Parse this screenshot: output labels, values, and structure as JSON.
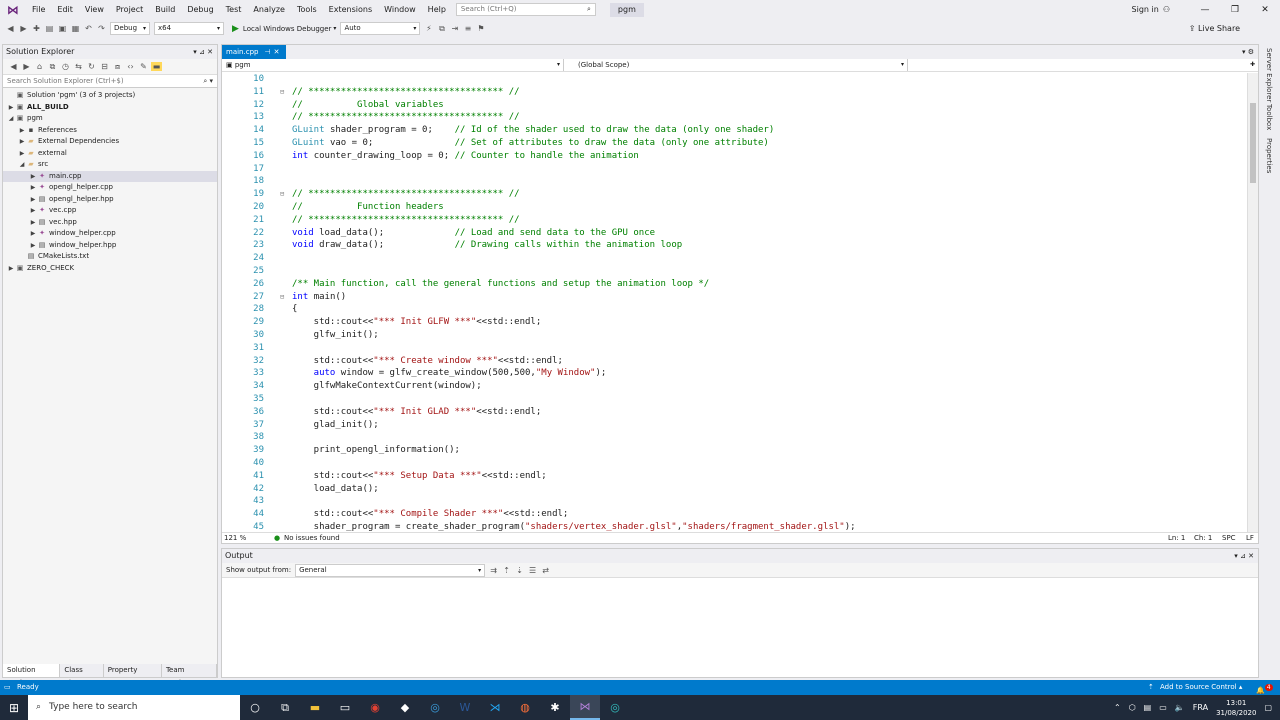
{
  "menubar": {
    "items": [
      "File",
      "Edit",
      "View",
      "Project",
      "Build",
      "Debug",
      "Test",
      "Analyze",
      "Tools",
      "Extensions",
      "Window",
      "Help"
    ],
    "search_placeholder": "Search (Ctrl+Q)",
    "solution_title": "pgm",
    "signin": "Sign in"
  },
  "toolbar": {
    "config": "Debug",
    "platform": "x64",
    "debugger": "Local Windows Debugger",
    "auto": "Auto",
    "liveshare": "Live Share"
  },
  "solution_explorer": {
    "title": "Solution Explorer",
    "search_placeholder": "Search Solution Explorer (Ctrl+$)",
    "nodes": [
      {
        "label": "Solution 'pgm' (3 of 3 projects)",
        "level": 0,
        "twisty": "",
        "icon": "solution-icon"
      },
      {
        "label": "ALL_BUILD",
        "level": 0,
        "twisty": "▶",
        "icon": "project-icon",
        "bold": true
      },
      {
        "label": "pgm",
        "level": 0,
        "twisty": "◢",
        "icon": "project-icon"
      },
      {
        "label": "References",
        "level": 1,
        "twisty": "▶",
        "icon": "references-icon"
      },
      {
        "label": "External Dependencies",
        "level": 1,
        "twisty": "▶",
        "icon": "folder-icon"
      },
      {
        "label": "external",
        "level": 1,
        "twisty": "▶",
        "icon": "folder-icon"
      },
      {
        "label": "src",
        "level": 1,
        "twisty": "◢",
        "icon": "folder-icon"
      },
      {
        "label": "main.cpp",
        "level": 2,
        "twisty": "▶",
        "icon": "cpp-file-icon",
        "selected": true
      },
      {
        "label": "opengl_helper.cpp",
        "level": 2,
        "twisty": "▶",
        "icon": "cpp-file-icon"
      },
      {
        "label": "opengl_helper.hpp",
        "level": 2,
        "twisty": "▶",
        "icon": "hpp-file-icon"
      },
      {
        "label": "vec.cpp",
        "level": 2,
        "twisty": "▶",
        "icon": "cpp-file-icon"
      },
      {
        "label": "vec.hpp",
        "level": 2,
        "twisty": "▶",
        "icon": "hpp-file-icon"
      },
      {
        "label": "window_helper.cpp",
        "level": 2,
        "twisty": "▶",
        "icon": "cpp-file-icon"
      },
      {
        "label": "window_helper.hpp",
        "level": 2,
        "twisty": "▶",
        "icon": "hpp-file-icon"
      },
      {
        "label": "CMakeLists.txt",
        "level": 1,
        "twisty": "",
        "icon": "text-file-icon"
      },
      {
        "label": "ZERO_CHECK",
        "level": 0,
        "twisty": "▶",
        "icon": "project-icon"
      }
    ],
    "bottom_tabs": [
      "Solution Expl...",
      "Class View",
      "Property Man...",
      "Team Explorer"
    ]
  },
  "editor": {
    "tab_label": "main.cpp",
    "nav_left": "pgm",
    "nav_right": "(Global Scope)",
    "zoom": "121 %",
    "issues": "No issues found",
    "ln": "Ln: 1",
    "ch": "Ch: 1",
    "spc": "SPC",
    "lf": "LF",
    "lines": [
      {
        "n": "10",
        "t": []
      },
      {
        "n": "11",
        "f": "⊟",
        "t": [
          [
            "cm",
            "// ************************************ //"
          ]
        ]
      },
      {
        "n": "12",
        "t": [
          [
            "cm",
            "//          Global variables"
          ]
        ]
      },
      {
        "n": "13",
        "t": [
          [
            "cm",
            "// ************************************ //"
          ]
        ]
      },
      {
        "n": "14",
        "t": [
          [
            "ty",
            "GLuint"
          ],
          [
            "",
            "shader_program = 0;    "
          ],
          [
            "cm",
            "// Id of the shader used to draw the data (only one shader)"
          ]
        ]
      },
      {
        "n": "15",
        "t": [
          [
            "ty",
            "GLuint"
          ],
          [
            "",
            "vao = 0;               "
          ],
          [
            "cm",
            "// Set of attributes to draw the data (only one attribute)"
          ]
        ]
      },
      {
        "n": "16",
        "t": [
          [
            "kw",
            "int"
          ],
          [
            "",
            "counter_drawing_loop = 0; "
          ],
          [
            "cm",
            "// Counter to handle the animation"
          ]
        ]
      },
      {
        "n": "17",
        "t": []
      },
      {
        "n": "18",
        "t": []
      },
      {
        "n": "19",
        "f": "⊟",
        "t": [
          [
            "cm",
            "// ************************************ //"
          ]
        ]
      },
      {
        "n": "20",
        "t": [
          [
            "cm",
            "//          Function headers"
          ]
        ]
      },
      {
        "n": "21",
        "t": [
          [
            "cm",
            "// ************************************ //"
          ]
        ]
      },
      {
        "n": "22",
        "t": [
          [
            "kw",
            "void"
          ],
          [
            "",
            "load_data();             "
          ],
          [
            "cm",
            "// Load and send data to the GPU once"
          ]
        ]
      },
      {
        "n": "23",
        "t": [
          [
            "kw",
            "void"
          ],
          [
            "",
            "draw_data();             "
          ],
          [
            "cm",
            "// Drawing calls within the animation loop"
          ]
        ]
      },
      {
        "n": "24",
        "t": []
      },
      {
        "n": "25",
        "t": []
      },
      {
        "n": "26",
        "t": [
          [
            "cm",
            "/** Main function, call the general functions and setup the animation loop */"
          ]
        ]
      },
      {
        "n": "27",
        "f": "⊟",
        "t": [
          [
            "kw",
            "int"
          ],
          [
            "",
            "main()"
          ]
        ]
      },
      {
        "n": "28",
        "t": [
          [
            "",
            "{"
          ]
        ]
      },
      {
        "n": "29",
        "t": [
          [
            "",
            "    std::cout<<"
          ],
          [
            "st",
            "\"*** Init GLFW ***\""
          ],
          [
            "",
            "<<std::endl;"
          ]
        ]
      },
      {
        "n": "30",
        "t": [
          [
            "",
            "    glfw_init();"
          ]
        ]
      },
      {
        "n": "31",
        "t": []
      },
      {
        "n": "32",
        "t": [
          [
            "",
            "    std::cout<<"
          ],
          [
            "st",
            "\"*** Create window ***\""
          ],
          [
            "",
            "<<std::endl;"
          ]
        ]
      },
      {
        "n": "33",
        "t": [
          [
            "kw",
            "    auto"
          ],
          [
            "",
            "window = glfw_create_window(500,500,"
          ],
          [
            "st",
            "\"My Window\""
          ],
          [
            "",
            ");"
          ]
        ]
      },
      {
        "n": "34",
        "t": [
          [
            "",
            "    glfwMakeContextCurrent(window);"
          ]
        ]
      },
      {
        "n": "35",
        "t": []
      },
      {
        "n": "36",
        "t": [
          [
            "",
            "    std::cout<<"
          ],
          [
            "st",
            "\"*** Init GLAD ***\""
          ],
          [
            "",
            "<<std::endl;"
          ]
        ]
      },
      {
        "n": "37",
        "t": [
          [
            "",
            "    glad_init();"
          ]
        ]
      },
      {
        "n": "38",
        "t": []
      },
      {
        "n": "39",
        "t": [
          [
            "",
            "    print_opengl_information();"
          ]
        ]
      },
      {
        "n": "40",
        "t": []
      },
      {
        "n": "41",
        "t": [
          [
            "",
            "    std::cout<<"
          ],
          [
            "st",
            "\"*** Setup Data ***\""
          ],
          [
            "",
            "<<std::endl;"
          ]
        ]
      },
      {
        "n": "42",
        "t": [
          [
            "",
            "    load_data();"
          ]
        ]
      },
      {
        "n": "43",
        "t": []
      },
      {
        "n": "44",
        "t": [
          [
            "",
            "    std::cout<<"
          ],
          [
            "st",
            "\"*** Compile Shader ***\""
          ],
          [
            "",
            "<<std::endl;"
          ]
        ]
      },
      {
        "n": "45",
        "t": [
          [
            "",
            "    shader_program = create_shader_program("
          ],
          [
            "st",
            "\"shaders/vertex_shader.glsl\""
          ],
          [
            "",
            ","
          ],
          [
            "st",
            "\"shaders/fragment_shader.glsl\""
          ],
          [
            "",
            ");"
          ]
        ]
      }
    ]
  },
  "output": {
    "title": "Output",
    "show_from_label": "Show output from:",
    "source": "General"
  },
  "right_tabs": [
    "Server Explorer",
    "Toolbox",
    "Properties"
  ],
  "statusbar": {
    "ready": "Ready",
    "source_control": "Add to Source Control",
    "notif_count": "4"
  },
  "taskbar": {
    "search_placeholder": "Type here to search",
    "lang": "FRA",
    "time": "13:01",
    "date": "31/08/2020"
  }
}
